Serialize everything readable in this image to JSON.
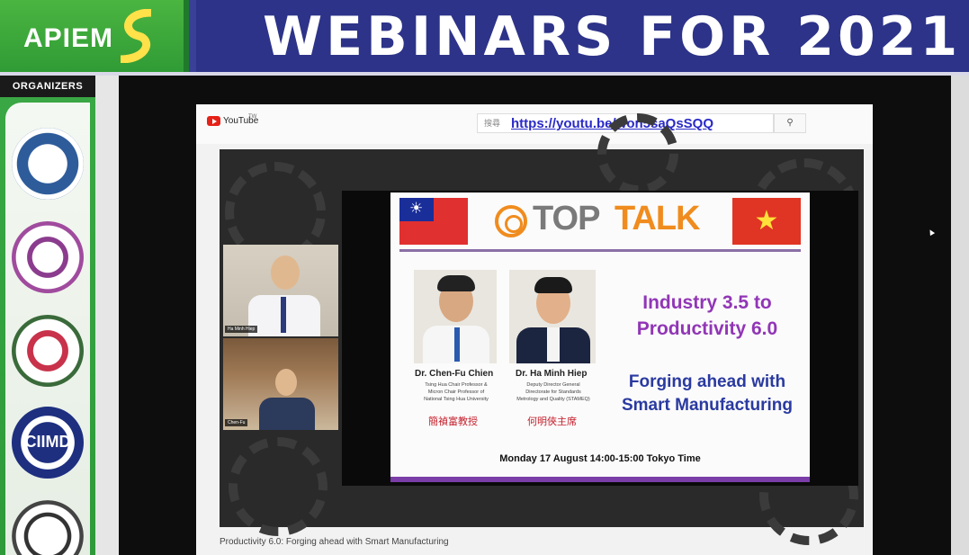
{
  "banner": {
    "logo_text": "APIEM",
    "title": "WEBINARS FOR 2021"
  },
  "organizers": {
    "label": "ORGANIZERS",
    "seals": [
      "university-seal",
      "university-seal",
      "university-seal",
      "ciimd-seal",
      "university-seal"
    ],
    "ciimd_text": "CIIMD"
  },
  "youtube": {
    "brand": "YouTube",
    "tm": "TW",
    "search_placeholder": "搜尋",
    "url": "https://youtu.be/won5saQsSQQ"
  },
  "camera": {
    "top_label": "Ha Minh Hiep",
    "bottom_label": "Chen-Fu"
  },
  "slide": {
    "brand_top": "TOP",
    "brand_talk": "TALK",
    "speakers": [
      {
        "name": "Dr. Chen-Fu Chien",
        "desc": [
          "Tsing Hua Chair Professor &",
          "Micron Chair Professor of",
          "National Tsing Hua University"
        ],
        "chinese": "簡禎富教授"
      },
      {
        "name": "Dr. Ha Minh Hiep",
        "desc": [
          "Deputy Director General",
          "Directorate for Standards",
          "Metrology and Quality (STAMEQ)"
        ],
        "chinese": "何明俠主席"
      }
    ],
    "title_line1": "Industry 3.5 to",
    "title_line2": "Productivity 6.0",
    "subtitle_line1": "Forging ahead with",
    "subtitle_line2": "Smart Manufacturing",
    "date": "Monday 17 August 14:00-15:00 Tokyo Time"
  },
  "caption": "Productivity 6.0: Forging ahead with Smart Manufacturing",
  "colors": {
    "banner_blue": "#2d3388",
    "logo_green": "#3aa845",
    "toptalk_orange": "#f08c1e",
    "title_purple": "#9136b6",
    "subtitle_blue": "#2a3aa0",
    "link_blue": "#2a2ac8"
  }
}
